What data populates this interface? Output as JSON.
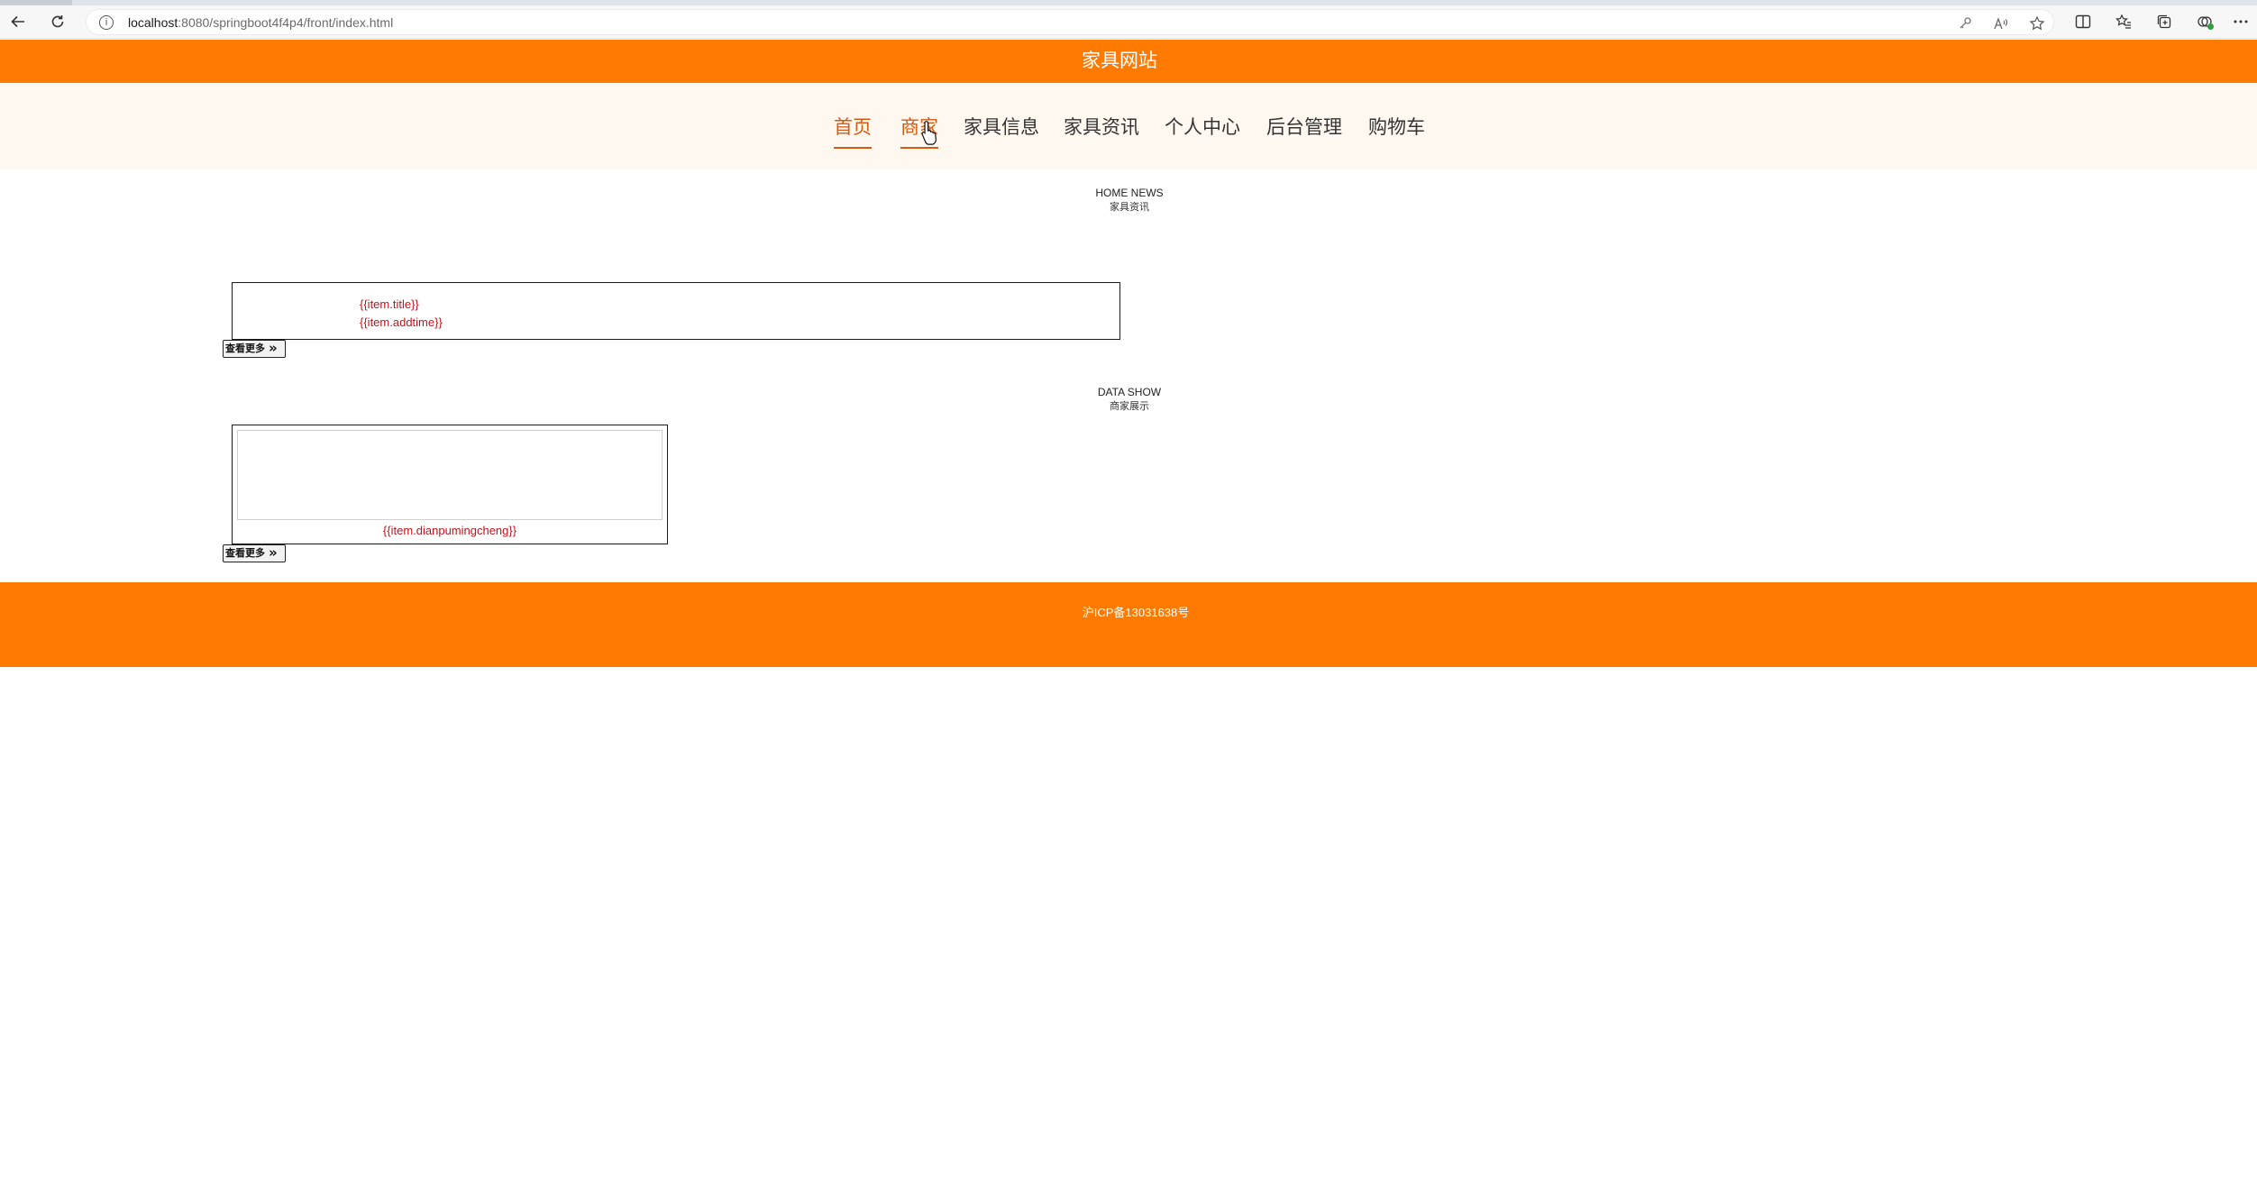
{
  "browser": {
    "url_host": "localhost",
    "url_rest": ":8080/springboot4f4p4/front/index.html"
  },
  "site": {
    "title": "家具网站"
  },
  "nav": {
    "items": [
      {
        "label": "首页",
        "active": true
      },
      {
        "label": "商家",
        "active": true
      },
      {
        "label": "家具信息",
        "active": false
      },
      {
        "label": "家具资讯",
        "active": false
      },
      {
        "label": "个人中心",
        "active": false
      },
      {
        "label": "后台管理",
        "active": false
      },
      {
        "label": "购物车",
        "active": false
      }
    ]
  },
  "news_section": {
    "heading_en": "HOME NEWS",
    "heading_cn": "家具资讯",
    "item_title": "{{item.title}}",
    "item_time": "{{item.addtime}}",
    "more_label": "查看更多",
    "more_chevron": "»"
  },
  "shop_section": {
    "heading_en": "DATA SHOW",
    "heading_cn": "商家展示",
    "item_name": "{{item.dianpumingcheng}}",
    "more_label": "查看更多",
    "more_chevron": "»"
  },
  "footer": {
    "icp": "沪ICP备13031638号"
  },
  "colors": {
    "brand_orange": "#ff7a00",
    "nav_active": "#d65a0f",
    "template_red": "#c0141a",
    "nav_bg": "#fff8f1"
  }
}
